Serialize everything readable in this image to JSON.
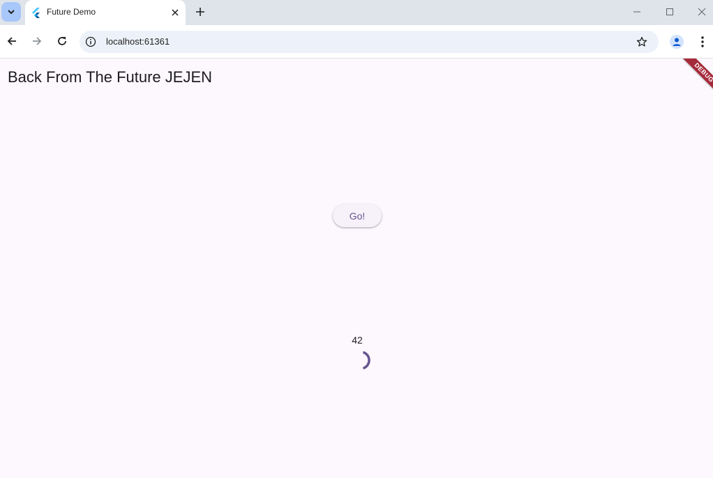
{
  "browser": {
    "tab": {
      "title": "Future Demo"
    },
    "address_bar": {
      "url": "localhost:61361"
    },
    "icons": {
      "tab_search": "chevron-down-icon",
      "favicon": "flutter-icon",
      "tab_close": "close-icon",
      "new_tab": "plus-icon",
      "minimize": "minimize-icon",
      "maximize": "maximize-icon",
      "close_window": "close-icon",
      "back": "arrow-left-icon",
      "forward": "arrow-right-icon",
      "reload": "reload-icon",
      "site_info": "info-icon",
      "bookmark": "star-icon",
      "profile": "person-icon",
      "menu": "more-vert-icon"
    }
  },
  "app": {
    "title": "Back From The Future JEJEN",
    "go_button_label": "Go!",
    "result": "42",
    "debug_banner": "DEBUG",
    "colors": {
      "background": "#fdf7fe",
      "accent": "#65558f",
      "debug_banner": "#a52a3a"
    }
  }
}
